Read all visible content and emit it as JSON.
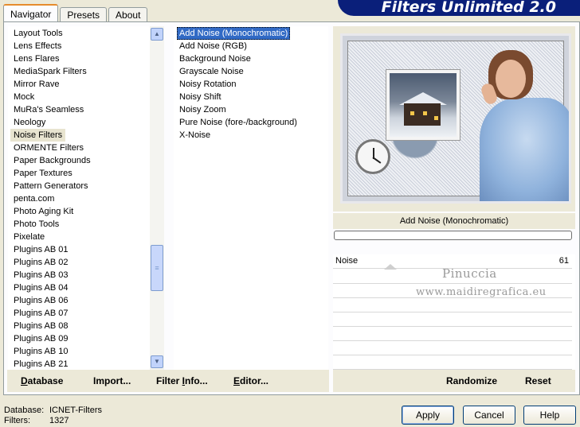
{
  "app": {
    "title": "Filters Unlimited 2.0"
  },
  "tabs": [
    {
      "label": "Navigator",
      "active": true
    },
    {
      "label": "Presets",
      "active": false
    },
    {
      "label": "About",
      "active": false
    }
  ],
  "categories": {
    "items": [
      "Layout Tools",
      "Lens Effects",
      "Lens Flares",
      "MediaSpark Filters",
      "Mirror Rave",
      "Mock",
      "MuRa's Seamless",
      "Neology",
      "Noise Filters",
      "ORMENTE Filters",
      "Paper Backgrounds",
      "Paper Textures",
      "Pattern Generators",
      "penta.com",
      "Photo Aging Kit",
      "Photo Tools",
      "Pixelate",
      "Plugins AB 01",
      "Plugins AB 02",
      "Plugins AB 03",
      "Plugins AB 04",
      "Plugins AB 06",
      "Plugins AB 07",
      "Plugins AB 08",
      "Plugins AB 09",
      "Plugins AB 10",
      "Plugins AB 21"
    ],
    "selected_index": 8
  },
  "filters": {
    "items": [
      "Add Noise (Monochromatic)",
      "Add Noise (RGB)",
      "Background Noise",
      "Grayscale Noise",
      "Noisy Rotation",
      "Noisy Shift",
      "Noisy Zoom",
      "Pure Noise (fore-/background)",
      "X-Noise"
    ],
    "selected_index": 0
  },
  "preview": {
    "filter_name": "Add Noise (Monochromatic)",
    "progress_percent": 0
  },
  "params": [
    {
      "label": "Noise",
      "value": "61"
    }
  ],
  "watermark": {
    "line1": "Pinuccia",
    "line2": "www.maidiregrafica.eu"
  },
  "left_buttons": {
    "database": {
      "u": "D",
      "rest": "atabase"
    },
    "import": {
      "pre": "Import",
      "rest": "..."
    },
    "filter_info": {
      "pre": "Filter ",
      "u": "I",
      "rest": "nfo..."
    },
    "editor": {
      "u": "E",
      "rest": "ditor..."
    }
  },
  "right_buttons": {
    "randomize": "Randomize",
    "reset": "Reset"
  },
  "status": {
    "database_label": "Database:",
    "database_value": "ICNET-Filters",
    "filters_label": "Filters:",
    "filters_value": "1327"
  },
  "dialog_buttons": {
    "apply": "Apply",
    "cancel": "Cancel",
    "help": "Help"
  },
  "colors": {
    "selection": "#316ac5",
    "banner": "#0a1f7a",
    "face": "#ece9d8"
  }
}
